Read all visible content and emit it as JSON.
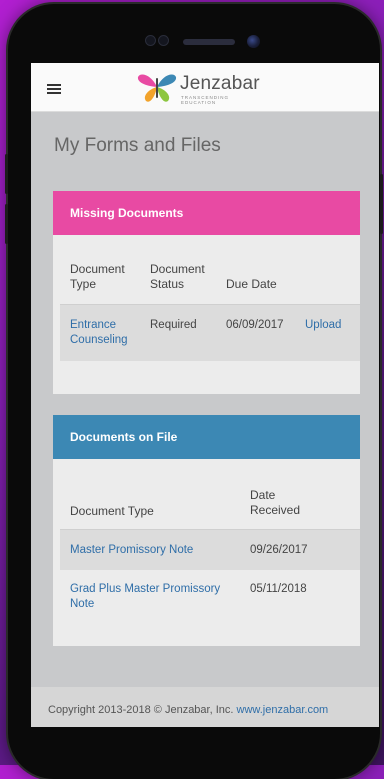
{
  "header": {
    "brand": "Jenzabar",
    "tagline": "TRANSCENDING EDUCATION",
    "menu_icon": "hamburger-menu-icon"
  },
  "page": {
    "title": "My Forms and Files"
  },
  "missing": {
    "title": "Missing Documents",
    "columns": [
      "Document Type",
      "Document Status",
      "Due Date",
      ""
    ],
    "rows": [
      {
        "type": "Entrance Counseling",
        "status": "Required",
        "due": "06/09/2017",
        "action": "Upload"
      }
    ]
  },
  "on_file": {
    "title": "Documents on File",
    "columns": [
      "Document Type",
      "Date Received"
    ],
    "rows": [
      {
        "type": "Master Promissory Note",
        "received": "09/26/2017"
      },
      {
        "type": "Grad Plus Master Promissory Note",
        "received": "05/11/2018"
      }
    ]
  },
  "footer": {
    "copyright": "Copyright 2013-2018 © Jenzabar, Inc.",
    "link": "www.jenzabar.com"
  },
  "colors": {
    "missing_header": "#e84aa3",
    "on_file_header": "#3c88b4",
    "link": "#2f6ea8"
  }
}
